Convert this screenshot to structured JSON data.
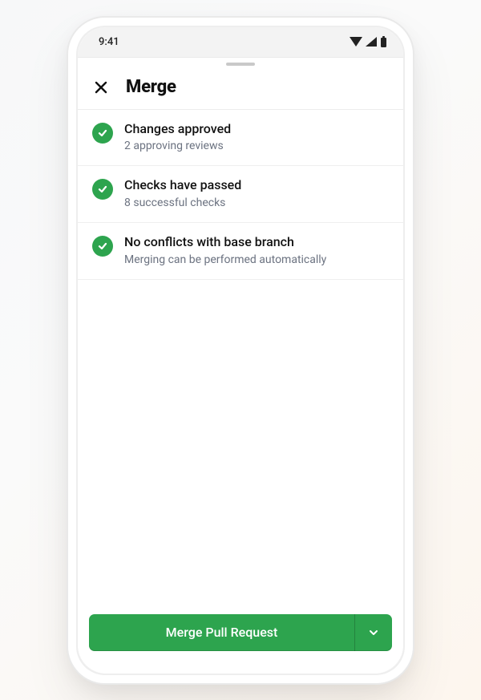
{
  "status_bar": {
    "time": "9:41"
  },
  "header": {
    "title": "Merge"
  },
  "checks": [
    {
      "title": "Changes approved",
      "subtitle": "2 approving reviews"
    },
    {
      "title": "Checks have passed",
      "subtitle": "8 successful checks"
    },
    {
      "title": "No conflicts with base branch",
      "subtitle": "Merging can be performed automatically"
    }
  ],
  "footer": {
    "merge_button_label": "Merge Pull Request"
  },
  "colors": {
    "success": "#2da44e"
  }
}
